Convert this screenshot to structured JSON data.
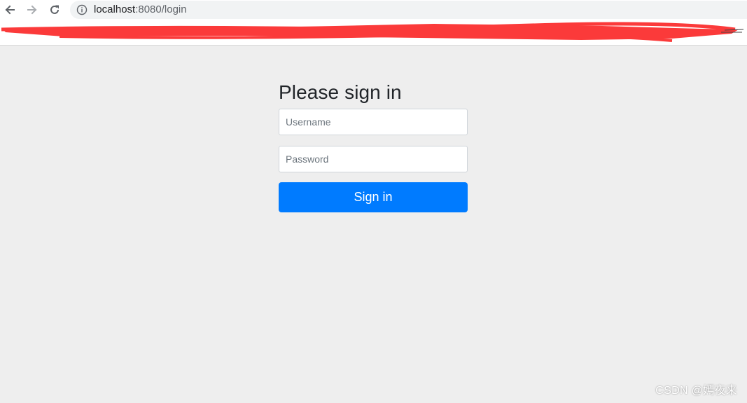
{
  "browser": {
    "back_icon": "arrow-left-icon",
    "forward_icon": "arrow-right-icon",
    "reload_icon": "reload-icon",
    "site_info_icon": "info-icon",
    "url_host": "localhost",
    "url_rest": ":8080/login"
  },
  "login": {
    "heading": "Please sign in",
    "username_placeholder": "Username",
    "password_placeholder": "Password",
    "submit_label": "Sign in"
  },
  "watermark": {
    "text": "CSDN @嫣夜来"
  },
  "colors": {
    "primary": "#007bff",
    "page_background": "#eeeeee",
    "redaction": "#fb3a3a"
  }
}
